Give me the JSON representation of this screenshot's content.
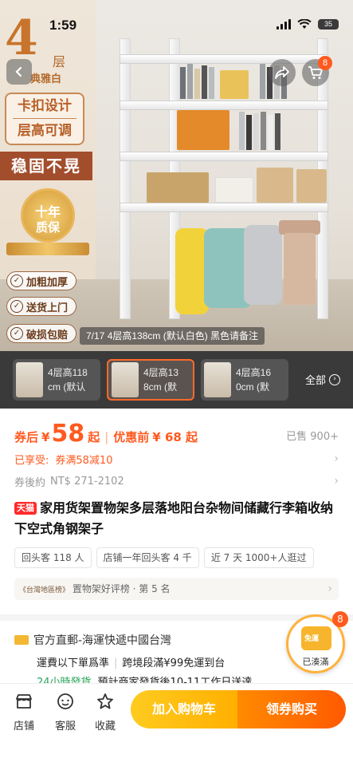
{
  "status_bar": {
    "time": "1:59",
    "battery": "35"
  },
  "hero": {
    "badge_number": "4",
    "badge_unit": "层",
    "badge_sub": "典雅白",
    "feature_box": [
      "卡扣设计",
      "层高可调"
    ],
    "stable_label": "稳固不晃",
    "warranty": {
      "line1": "十年",
      "line2": "质保"
    },
    "features": [
      "加粗加厚",
      "送货上门",
      "破损包赔"
    ],
    "image_caption": "7/17 4层高138cm (默认白色) 黑色请备注",
    "cart_count": "8"
  },
  "variants": {
    "items": [
      {
        "label_line1": "4层高118",
        "label_line2": "cm (默认"
      },
      {
        "label_line1": "4层高13",
        "label_line2": "8cm (默"
      },
      {
        "label_line1": "4层高16",
        "label_line2": "0cm (默"
      }
    ],
    "all_label": "全部"
  },
  "price": {
    "after_coupon_label": "券后",
    "currency": "¥",
    "after_coupon_value": "58",
    "after_coupon_suffix": "起",
    "separator": "|",
    "before_label": "优惠前",
    "before_value": "¥ 68 起",
    "sold": "已售 900+"
  },
  "promo": {
    "enjoyed_label": "已享受:",
    "enjoyed_value": "券满58减10",
    "approx_label": "券後約",
    "approx_value": "NT$ 271-2102"
  },
  "product": {
    "store_tag": "天猫",
    "title": "家用货架置物架多层落地阳台杂物间储藏行李箱收纳下空式角钢架子"
  },
  "tags": [
    "回头客 118 人",
    "店铺一年回头客 4 千",
    "近 7 天 1000+人逛过"
  ],
  "rank": {
    "source": "《台灣地區榜》",
    "text": "置物架好评榜 · 第 5 名"
  },
  "shipping": {
    "line1": "官方直郵-海運快遞中國台灣",
    "line2a": "運費以下單爲準",
    "line2b": "跨境段滿¥99免運到台",
    "line3a": "24小時發貨",
    "line3b": "預計商家發貨後10-11工作日送達"
  },
  "free_badge": {
    "icon_text": "免運",
    "label": "已湊滿",
    "count": "8"
  },
  "bottom_bar": {
    "shop": "店铺",
    "service": "客服",
    "favorite": "收藏",
    "add_cart": "加入购物车",
    "buy": "领券购买"
  },
  "colors": {
    "accent": "#ff5a1f",
    "cart_button": "#ffb000",
    "buy_button": "#ff5a00"
  }
}
